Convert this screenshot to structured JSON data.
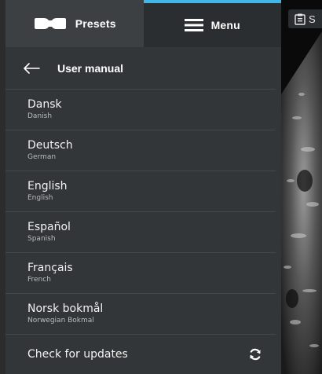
{
  "tabs": {
    "presets_label": "Presets",
    "menu_label": "Menu"
  },
  "header": {
    "title": "User manual"
  },
  "languages": [
    {
      "native": "Dansk",
      "english": "Danish"
    },
    {
      "native": "Deutsch",
      "english": "German"
    },
    {
      "native": "English",
      "english": "English"
    },
    {
      "native": "Español",
      "english": "Spanish"
    },
    {
      "native": "Français",
      "english": "French"
    },
    {
      "native": "Norsk bokmål",
      "english": "Norwegian Bokmal"
    }
  ],
  "update": {
    "label": "Check for updates",
    "icon": "refresh-icon"
  },
  "scan_chip": {
    "text": "S",
    "icon": "clipboard-icon"
  },
  "colors": {
    "accent": "#41b6e6",
    "panel": "#333638",
    "active_tab": "#2b2e30",
    "inactive_tab": "#3d4043"
  }
}
